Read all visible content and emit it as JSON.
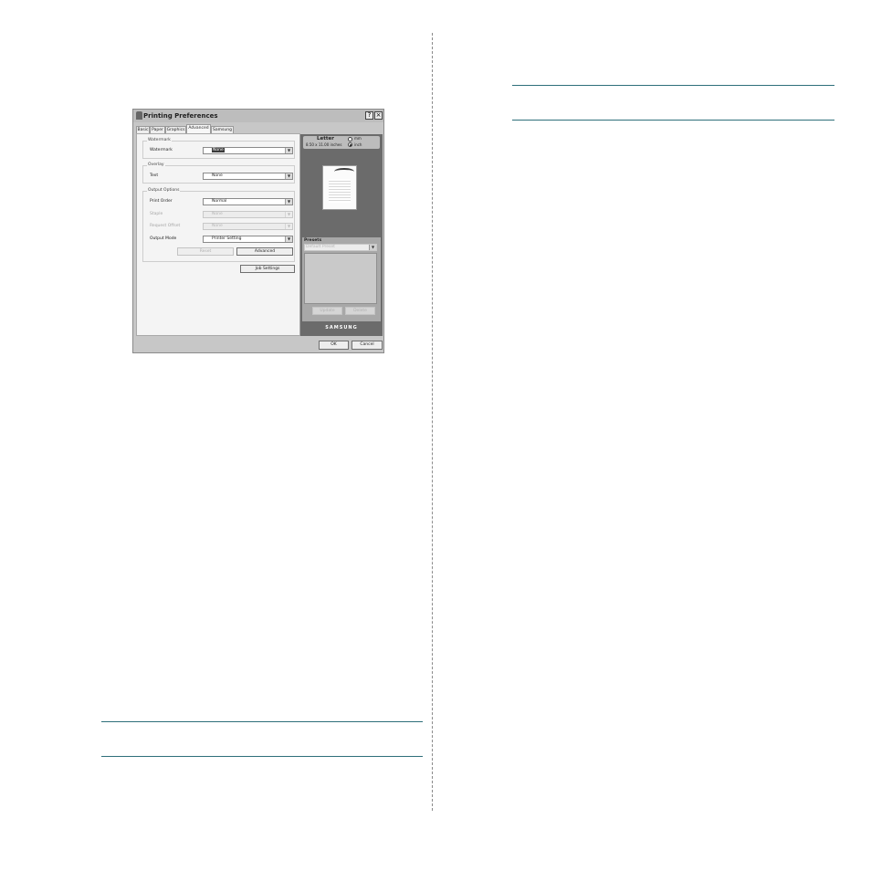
{
  "dialog": {
    "title": "Printing Preferences",
    "help_glyph": "?",
    "close_glyph": "×",
    "tabs": [
      {
        "label": "Basic"
      },
      {
        "label": "Paper"
      },
      {
        "label": "Graphics"
      },
      {
        "label": "Advanced"
      },
      {
        "label": "Samsung"
      }
    ],
    "active_tab": "Advanced",
    "watermark": {
      "group_title": "Watermark",
      "label": "Watermark",
      "value": "None"
    },
    "overlay": {
      "group_title": "Overlay",
      "label": "Text",
      "value": "None"
    },
    "output_options": {
      "group_title": "Output Options",
      "print_order_label": "Print Order",
      "print_order_value": "Normal",
      "staple_label": "Staple",
      "staple_value": "None",
      "request_offset_label": "Request Offset",
      "request_offset_value": "None",
      "output_mode_label": "Output Mode",
      "output_mode_value": "Printer Setting",
      "reset_label": "Reset",
      "advanced_label": "Advanced"
    },
    "job_settings_label": "Job Settings",
    "preview": {
      "paper_name": "Letter",
      "paper_size": "8.50 x 11.00 inches",
      "unit_mm": "mm",
      "unit_inch": "inch",
      "selected_unit": "inch"
    },
    "presets": {
      "title": "Presets",
      "selected": "Default Preset",
      "update_label": "Update",
      "delete_label": "Delete"
    },
    "brand": "SAMSUNG",
    "ok_label": "OK",
    "cancel_label": "Cancel"
  }
}
